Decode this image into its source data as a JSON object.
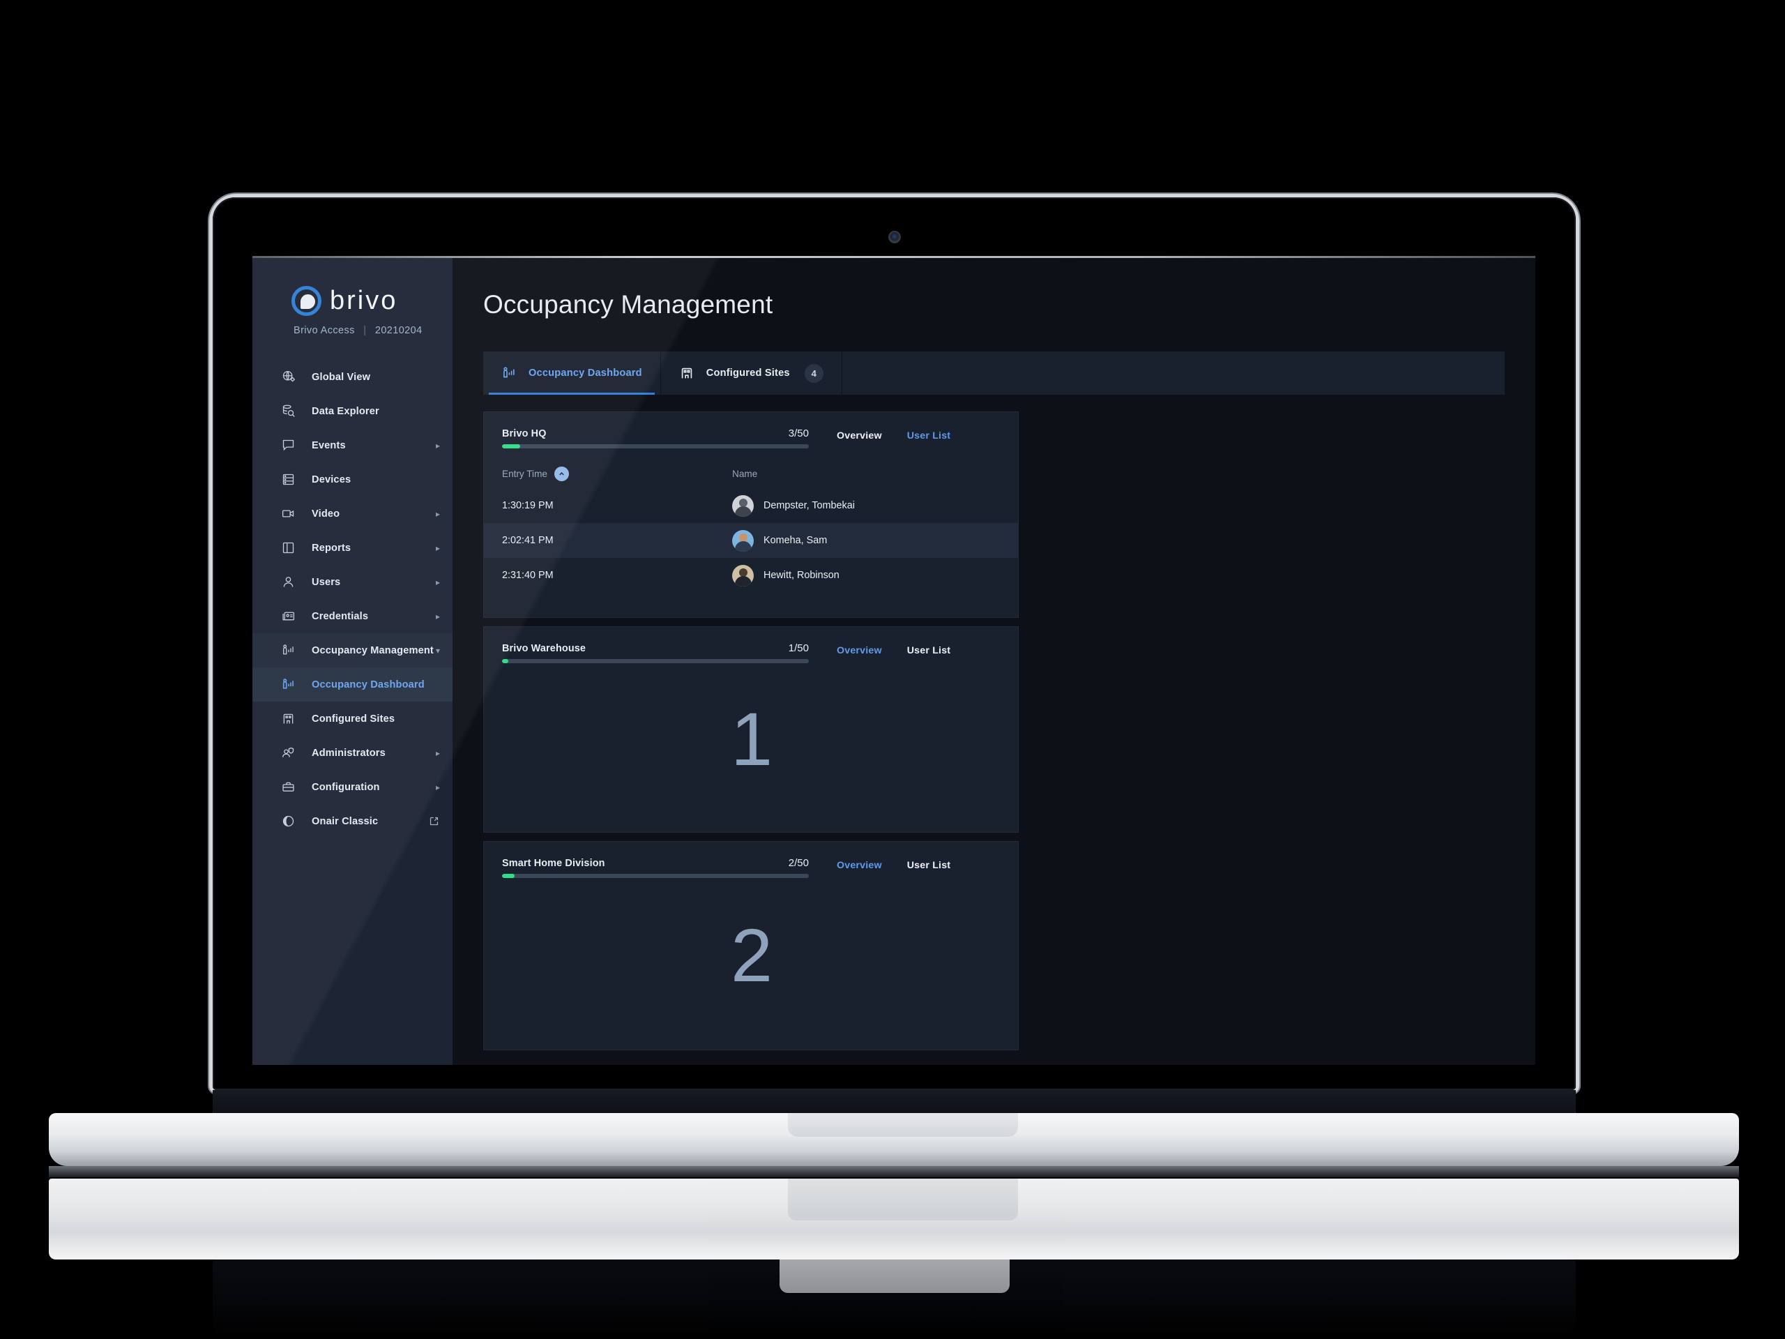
{
  "brand": {
    "word": "brivo",
    "product": "Brivo Access",
    "divider": "|",
    "version": "20210204",
    "logo_icon": "brivo-logo-icon"
  },
  "sidebar": {
    "items": [
      {
        "label": "Global View",
        "icon": "globe-view-icon",
        "caret": "",
        "active": false
      },
      {
        "label": "Data Explorer",
        "icon": "data-explorer-icon",
        "caret": "",
        "active": false
      },
      {
        "label": "Events",
        "icon": "events-icon",
        "caret": "▸",
        "active": false
      },
      {
        "label": "Devices",
        "icon": "devices-icon",
        "caret": "",
        "active": false
      },
      {
        "label": "Video",
        "icon": "video-camera-icon",
        "caret": "▸",
        "active": false
      },
      {
        "label": "Reports",
        "icon": "reports-icon",
        "caret": "▸",
        "active": false
      },
      {
        "label": "Users",
        "icon": "user-icon",
        "caret": "▸",
        "active": false
      },
      {
        "label": "Credentials",
        "icon": "credentials-card-icon",
        "caret": "▸",
        "active": false
      },
      {
        "label": "Occupancy Management",
        "icon": "occupancy-icon",
        "caret": "▾",
        "active": false
      },
      {
        "label": "Occupancy Dashboard",
        "icon": "occupancy-icon",
        "caret": "",
        "active": true
      },
      {
        "label": "Configured Sites",
        "icon": "building-icon",
        "caret": "",
        "active": false
      },
      {
        "label": "Administrators",
        "icon": "administrators-icon",
        "caret": "▸",
        "active": false
      },
      {
        "label": "Configuration",
        "icon": "toolbox-icon",
        "caret": "▸",
        "active": false
      },
      {
        "label": "Onair Classic",
        "icon": "onair-icon",
        "caret": "",
        "active": false,
        "external": "external-link-icon"
      }
    ]
  },
  "main": {
    "page_title": "Occupancy Management",
    "tabs": [
      {
        "label": "Occupancy Dashboard",
        "icon": "occupancy-icon",
        "badge": "",
        "active": true
      },
      {
        "label": "Configured Sites",
        "icon": "building-icon",
        "badge": "4",
        "active": false
      }
    ],
    "cards": [
      {
        "site": "Brivo HQ",
        "count": "3/50",
        "occupied": 3,
        "capacity": 50,
        "view": "userlist",
        "actions": {
          "overview": "Overview",
          "user_list": "User List"
        },
        "columns": {
          "time": "Entry Time",
          "name": "Name"
        },
        "sort_icon": "sort-ascending-icon",
        "rows": [
          {
            "time": "1:30:19 PM",
            "name": "Dempster, Tombekai",
            "avatar": "av1"
          },
          {
            "time": "2:02:41 PM",
            "name": "Komeha, Sam",
            "avatar": "av2"
          },
          {
            "time": "2:31:40 PM",
            "name": "Hewitt, Robinson",
            "avatar": "av3"
          }
        ]
      },
      {
        "site": "Brivo Warehouse",
        "count": "1/50",
        "occupied": 1,
        "capacity": 50,
        "view": "overview",
        "actions": {
          "overview": "Overview",
          "user_list": "User List"
        },
        "big_number": "1"
      },
      {
        "site": "Smart Home Division",
        "count": "2/50",
        "occupied": 2,
        "capacity": 50,
        "view": "overview",
        "actions": {
          "overview": "Overview",
          "user_list": "User List"
        },
        "big_number": "2"
      }
    ]
  },
  "colors": {
    "accent_blue": "#2f7fe0",
    "link_blue": "#5e9be9",
    "meter_green": "#2ddd8a",
    "sidebar_bg": "#1d2433",
    "card_bg": "#1a212e",
    "app_bg": "#0d1016"
  }
}
